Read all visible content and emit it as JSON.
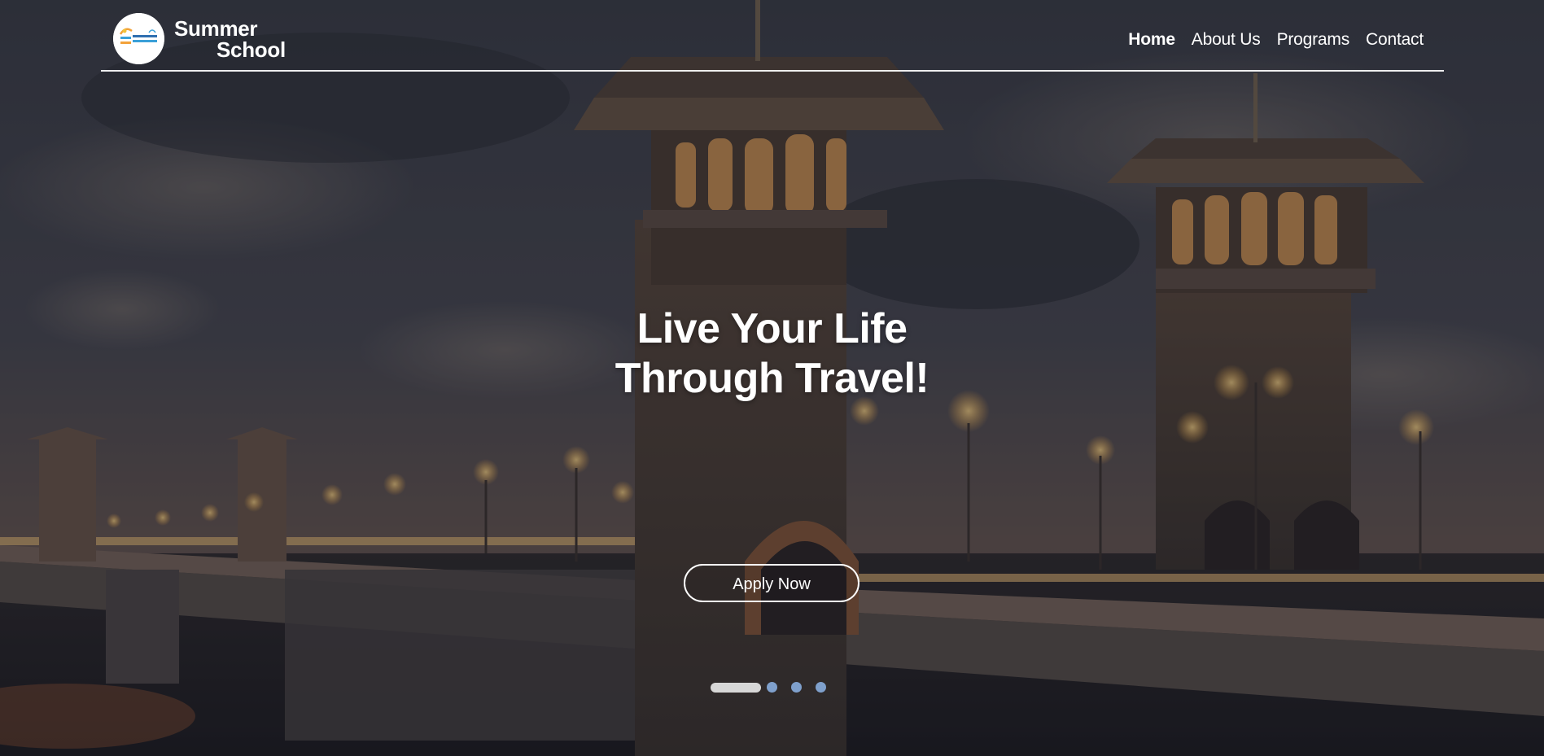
{
  "brand": {
    "logo_icon": "summer-school-logo",
    "name_line1": "Summer",
    "name_line2": "School"
  },
  "nav": {
    "items": [
      {
        "label": "Home",
        "active": true
      },
      {
        "label": "About Us",
        "active": false
      },
      {
        "label": "Programs",
        "active": false
      },
      {
        "label": "Contact",
        "active": false
      }
    ]
  },
  "hero": {
    "headline_line1": "Live Your Life",
    "headline_line2": "Through Travel!",
    "cta_label": "Apply Now",
    "background": "night-bridge-with-towers-photo"
  },
  "carousel": {
    "slide_count": 4,
    "active_index": 0
  },
  "colors": {
    "text": "#ffffff",
    "dot_inactive": "#7fa0cc",
    "dot_active": "#d7d7d7"
  }
}
